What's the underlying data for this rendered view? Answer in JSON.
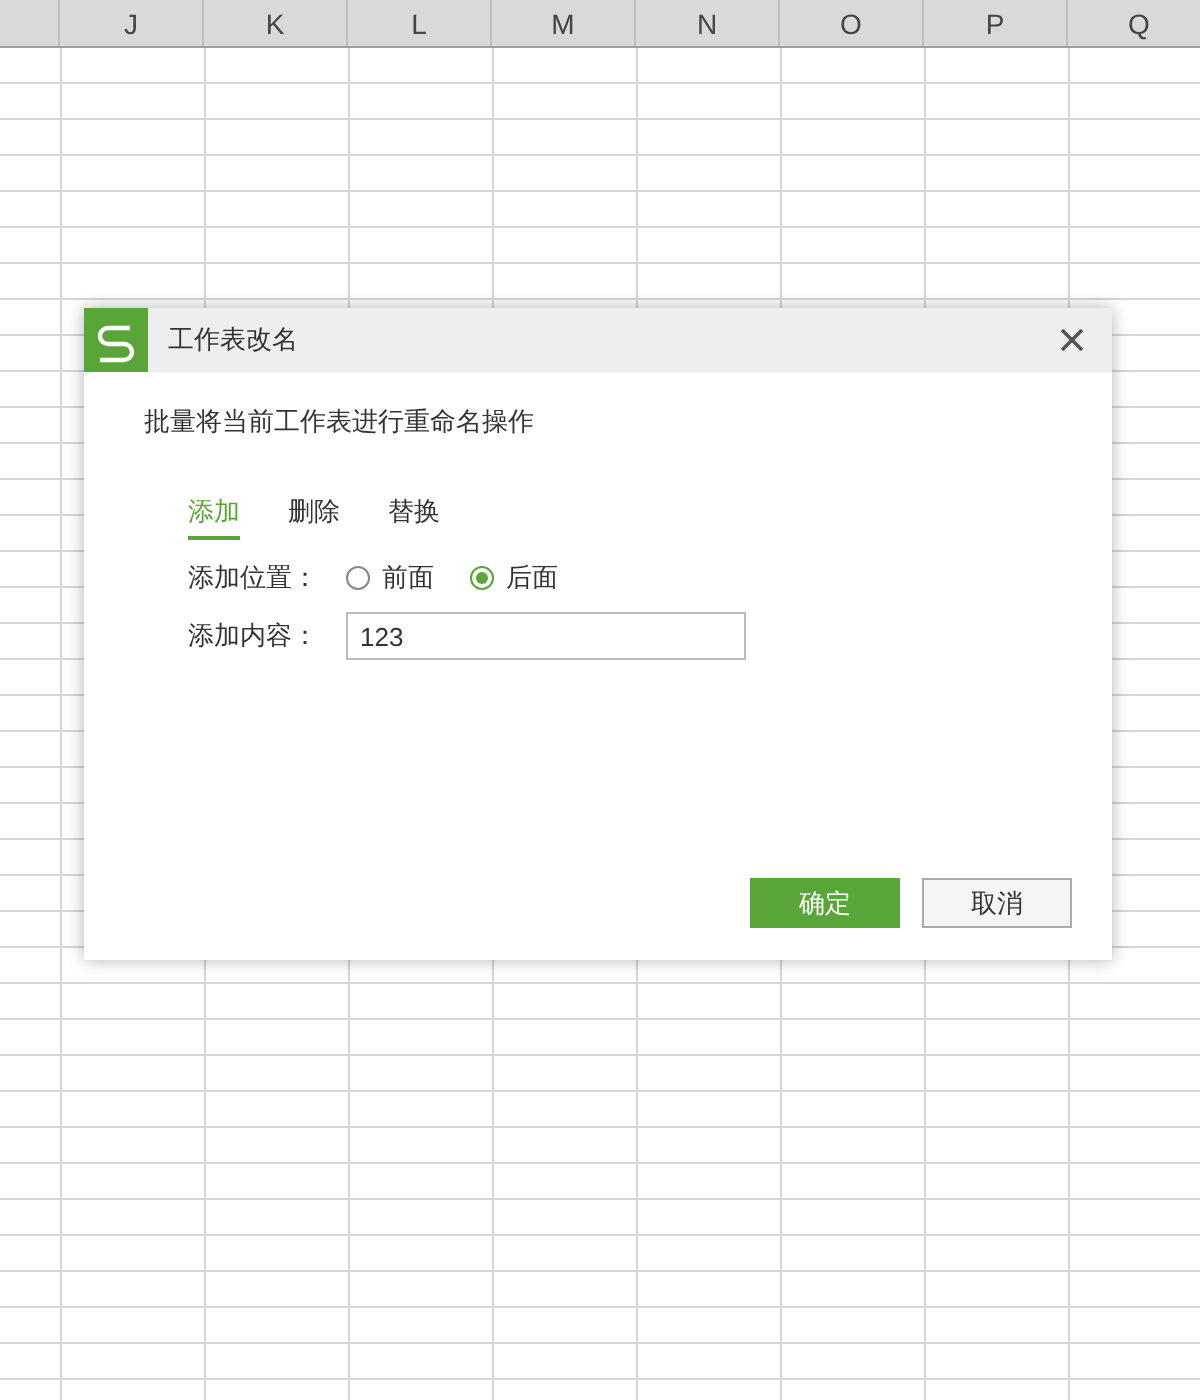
{
  "sheet": {
    "columns": [
      "J",
      "K",
      "L",
      "M",
      "N",
      "O",
      "P",
      "Q"
    ]
  },
  "dialog": {
    "title": "工作表改名",
    "description": "批量将当前工作表进行重命名操作",
    "tabs": [
      {
        "label": "添加",
        "selected": true
      },
      {
        "label": "删除",
        "selected": false
      },
      {
        "label": "替换",
        "selected": false
      }
    ],
    "position": {
      "label": "添加位置：",
      "options": [
        {
          "label": "前面",
          "selected": false
        },
        {
          "label": "后面",
          "selected": true
        }
      ]
    },
    "content": {
      "label": "添加内容：",
      "value": "123"
    },
    "buttons": [
      {
        "label": "确定",
        "kind": "primary"
      },
      {
        "label": "取消",
        "kind": "secondary"
      }
    ]
  }
}
